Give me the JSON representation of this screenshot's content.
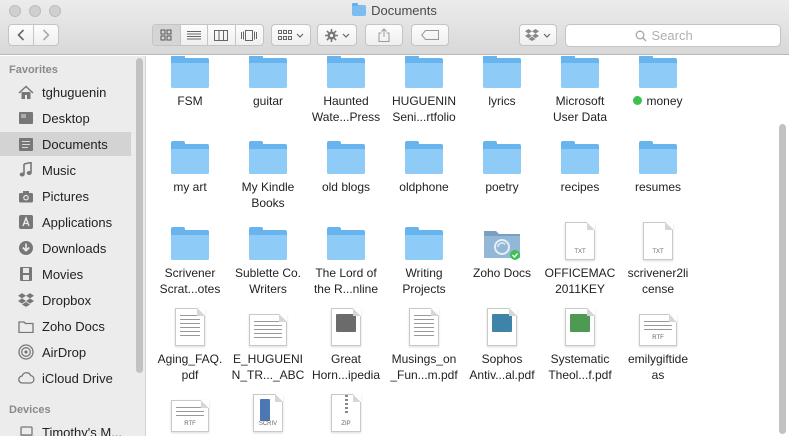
{
  "window": {
    "title": "Documents"
  },
  "toolbar": {
    "search_placeholder": "Search"
  },
  "sidebar": {
    "favorites_heading": "Favorites",
    "items": [
      {
        "label": "tghuguenin",
        "icon": "home-icon"
      },
      {
        "label": "Desktop",
        "icon": "desktop-icon"
      },
      {
        "label": "Documents",
        "icon": "documents-icon"
      },
      {
        "label": "Music",
        "icon": "music-icon"
      },
      {
        "label": "Pictures",
        "icon": "camera-icon"
      },
      {
        "label": "Applications",
        "icon": "applications-icon"
      },
      {
        "label": "Downloads",
        "icon": "download-icon"
      },
      {
        "label": "Movies",
        "icon": "film-icon"
      },
      {
        "label": "Dropbox",
        "icon": "dropbox-icon"
      },
      {
        "label": "Zoho Docs",
        "icon": "folder-icon"
      },
      {
        "label": "AirDrop",
        "icon": "airdrop-icon"
      },
      {
        "label": "iCloud Drive",
        "icon": "cloud-icon"
      }
    ],
    "devices_heading": "Devices",
    "devices": [
      {
        "label": "Timothy's M..."
      }
    ]
  },
  "files": [
    {
      "label": "FSM"
    },
    {
      "label": "guitar"
    },
    {
      "label": "Haunted\nWate...Press"
    },
    {
      "label": "HUGUENIN\nSeni...rtfolio"
    },
    {
      "label": "lyrics"
    },
    {
      "label": "Microsoft\nUser Data"
    },
    {
      "label": "money"
    },
    {
      "label": "my art"
    },
    {
      "label": "My Kindle\nBooks"
    },
    {
      "label": "old blogs"
    },
    {
      "label": "oldphone"
    },
    {
      "label": "poetry"
    },
    {
      "label": "recipes"
    },
    {
      "label": "resumes"
    },
    {
      "label": "Scrivener\nScrat...otes"
    },
    {
      "label": "Sublette Co.\nWriters"
    },
    {
      "label": "The Lord of\nthe R...nline"
    },
    {
      "label": "Writing\nProjects"
    },
    {
      "label": "Zoho Docs"
    },
    {
      "label": "OFFICEMAC\n2011KEY",
      "tag": "TXT"
    },
    {
      "label": "scrivener2li\ncense",
      "tag": "TXT"
    },
    {
      "label": "Aging_FAQ.\npdf"
    },
    {
      "label": "E_HUGUENI\nN_TR..._ABC"
    },
    {
      "label": "Great\nHorn...ipedia"
    },
    {
      "label": "Musings_on\n_Fun...m.pdf"
    },
    {
      "label": "Sophos\nAntiv...al.pdf"
    },
    {
      "label": "Systematic\nTheol...f.pdf"
    },
    {
      "label": "emilygiftide\nas",
      "tag": "RTF"
    },
    {
      "label": "",
      "tag": "RTF"
    },
    {
      "label": "",
      "tag": "SCRIV"
    },
    {
      "label": "",
      "tag": "ZIP"
    }
  ],
  "colors": {
    "folder": "#67b4ee",
    "folder_front": "#8ecbf6",
    "tag_green": "#3cc24f",
    "selection": "#d3d3d3"
  }
}
